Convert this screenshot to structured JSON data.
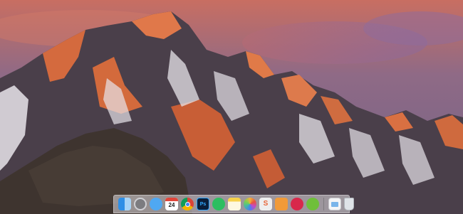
{
  "dock": {
    "apps": [
      {
        "name": "finder-icon",
        "label": ""
      },
      {
        "name": "system-preferences-icon",
        "label": ""
      },
      {
        "name": "messages-icon",
        "label": ""
      },
      {
        "name": "calendar-icon",
        "label": "24"
      },
      {
        "name": "chrome-icon",
        "label": ""
      },
      {
        "name": "photoshop-icon",
        "label": "Ps"
      },
      {
        "name": "evernote-icon",
        "label": ""
      },
      {
        "name": "notes-icon",
        "label": ""
      },
      {
        "name": "photos-icon",
        "label": ""
      },
      {
        "name": "sublime-text-icon",
        "label": "S"
      },
      {
        "name": "ibooks-icon",
        "label": ""
      },
      {
        "name": "lips-app-icon",
        "label": ""
      },
      {
        "name": "cyberduck-icon",
        "label": ""
      }
    ],
    "stacks": [
      {
        "name": "downloads-folder-icon"
      },
      {
        "name": "trash-icon"
      }
    ]
  },
  "colors": {
    "sky_top": "#6b4a66",
    "sky_mid": "#9a6470",
    "mountain_shadow": "#3b3338",
    "mountain_lit": "#d9703e",
    "snow": "#e8e6ec"
  }
}
